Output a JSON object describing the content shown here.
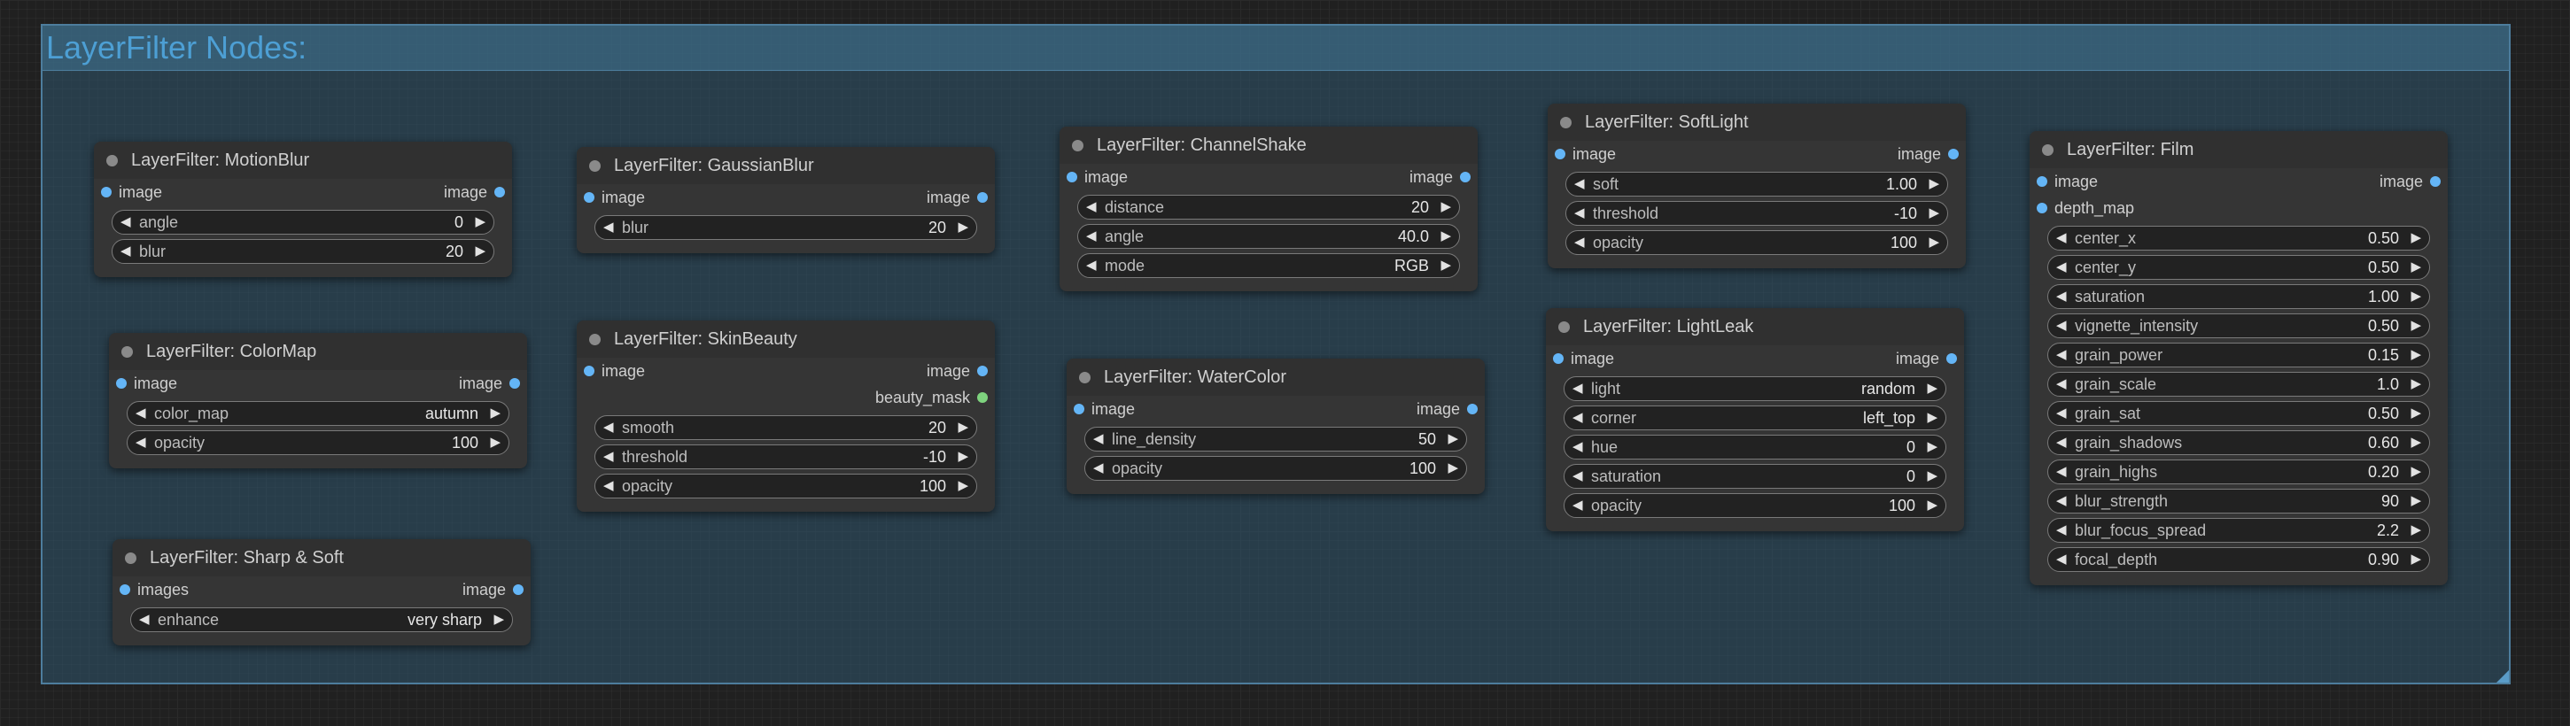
{
  "group": {
    "title": "LayerFilter Nodes:"
  },
  "nodes": {
    "motionblur": {
      "title": "LayerFilter: MotionBlur",
      "inputs": [
        "image"
      ],
      "outputs": [
        "image"
      ],
      "widgets": [
        {
          "name": "angle",
          "value": "0"
        },
        {
          "name": "blur",
          "value": "20"
        }
      ]
    },
    "gaussianblur": {
      "title": "LayerFilter: GaussianBlur",
      "inputs": [
        "image"
      ],
      "outputs": [
        "image"
      ],
      "widgets": [
        {
          "name": "blur",
          "value": "20"
        }
      ]
    },
    "channelshake": {
      "title": "LayerFilter: ChannelShake",
      "inputs": [
        "image"
      ],
      "outputs": [
        "image"
      ],
      "widgets": [
        {
          "name": "distance",
          "value": "20"
        },
        {
          "name": "angle",
          "value": "40.0"
        },
        {
          "name": "mode",
          "value": "RGB"
        }
      ]
    },
    "softlight": {
      "title": "LayerFilter: SoftLight",
      "inputs": [
        "image"
      ],
      "outputs": [
        "image"
      ],
      "widgets": [
        {
          "name": "soft",
          "value": "1.00"
        },
        {
          "name": "threshold",
          "value": "-10"
        },
        {
          "name": "opacity",
          "value": "100"
        }
      ]
    },
    "film": {
      "title": "LayerFilter: Film",
      "inputs": [
        "image",
        "depth_map"
      ],
      "outputs": [
        "image"
      ],
      "widgets": [
        {
          "name": "center_x",
          "value": "0.50"
        },
        {
          "name": "center_y",
          "value": "0.50"
        },
        {
          "name": "saturation",
          "value": "1.00"
        },
        {
          "name": "vignette_intensity",
          "value": "0.50"
        },
        {
          "name": "grain_power",
          "value": "0.15"
        },
        {
          "name": "grain_scale",
          "value": "1.0"
        },
        {
          "name": "grain_sat",
          "value": "0.50"
        },
        {
          "name": "grain_shadows",
          "value": "0.60"
        },
        {
          "name": "grain_highs",
          "value": "0.20"
        },
        {
          "name": "blur_strength",
          "value": "90"
        },
        {
          "name": "blur_focus_spread",
          "value": "2.2"
        },
        {
          "name": "focal_depth",
          "value": "0.90"
        }
      ]
    },
    "colormap": {
      "title": "LayerFilter: ColorMap",
      "inputs": [
        "image"
      ],
      "outputs": [
        "image"
      ],
      "widgets": [
        {
          "name": "color_map",
          "value": "autumn"
        },
        {
          "name": "opacity",
          "value": "100"
        }
      ]
    },
    "skinbeauty": {
      "title": "LayerFilter: SkinBeauty",
      "inputs": [
        "image"
      ],
      "outputs": [
        "image",
        "beauty_mask"
      ],
      "widgets": [
        {
          "name": "smooth",
          "value": "20"
        },
        {
          "name": "threshold",
          "value": "-10"
        },
        {
          "name": "opacity",
          "value": "100"
        }
      ]
    },
    "watercolor": {
      "title": "LayerFilter: WaterColor",
      "inputs": [
        "image"
      ],
      "outputs": [
        "image"
      ],
      "widgets": [
        {
          "name": "line_density",
          "value": "50"
        },
        {
          "name": "opacity",
          "value": "100"
        }
      ]
    },
    "lightleak": {
      "title": "LayerFilter: LightLeak",
      "inputs": [
        "image"
      ],
      "outputs": [
        "image"
      ],
      "widgets": [
        {
          "name": "light",
          "value": "random"
        },
        {
          "name": "corner",
          "value": "left_top"
        },
        {
          "name": "hue",
          "value": "0"
        },
        {
          "name": "saturation",
          "value": "0"
        },
        {
          "name": "opacity",
          "value": "100"
        }
      ]
    },
    "sharpsoft": {
      "title": "LayerFilter: Sharp & Soft",
      "inputs": [
        "images"
      ],
      "outputs": [
        "image"
      ],
      "widgets": [
        {
          "name": "enhance",
          "value": "very sharp"
        }
      ]
    }
  },
  "icons": {
    "arrow_left": "◀",
    "arrow_right": "▶"
  },
  "colors": {
    "group_fill": "#30566e",
    "group_title": "#4d9fd4",
    "pin_image": "#64b5f6",
    "pin_mask": "#7ed37e"
  }
}
